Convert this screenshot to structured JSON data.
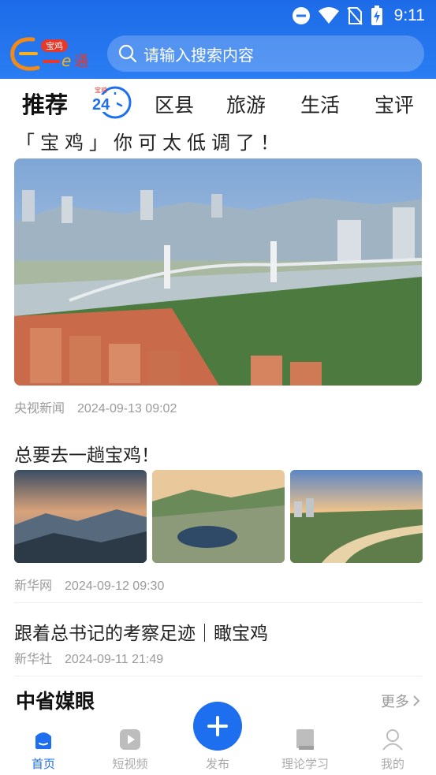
{
  "status_bar": {
    "time": "9:11"
  },
  "header": {
    "logo_text": "宝鸡一e通",
    "search": {
      "placeholder": "请输入搜索内容"
    }
  },
  "tabs": [
    {
      "label": "推荐",
      "active": true
    },
    {
      "label": "宝鸡24hours",
      "icon": "24-hours-clock-icon"
    },
    {
      "label": "区县"
    },
    {
      "label": "旅游"
    },
    {
      "label": "生活"
    },
    {
      "label": "宝评"
    }
  ],
  "feed": [
    {
      "title": "「宝鸡」你可太低调了！",
      "source": "央视新闻",
      "time": "2024-09-13 09:02",
      "image": "city-bridge-aerial-photo"
    },
    {
      "title": "总要去一趟宝鸡！",
      "source": "新华网",
      "time": "2024-09-12 09:30",
      "images": [
        "misty-mountains-photo",
        "mountain-lake-photo",
        "river-city-sunset-photo"
      ]
    },
    {
      "title": "跟着总书记的考察足迹｜瞰宝鸡",
      "source": "新华社",
      "time": "2024-09-11 21:49"
    }
  ],
  "section": {
    "title": "中省媒眼",
    "more_label": "更多"
  },
  "bottom_nav": [
    {
      "label": "首页",
      "icon": "home-icon",
      "active": true
    },
    {
      "label": "短视频",
      "icon": "video-play-icon"
    },
    {
      "label": "发布",
      "icon": "plus-icon"
    },
    {
      "label": "理论学习",
      "icon": "book-icon"
    },
    {
      "label": "我的",
      "icon": "user-icon"
    }
  ],
  "colors": {
    "brand_blue": "#1e6ff0",
    "meta_gray": "#9a9a9a"
  }
}
